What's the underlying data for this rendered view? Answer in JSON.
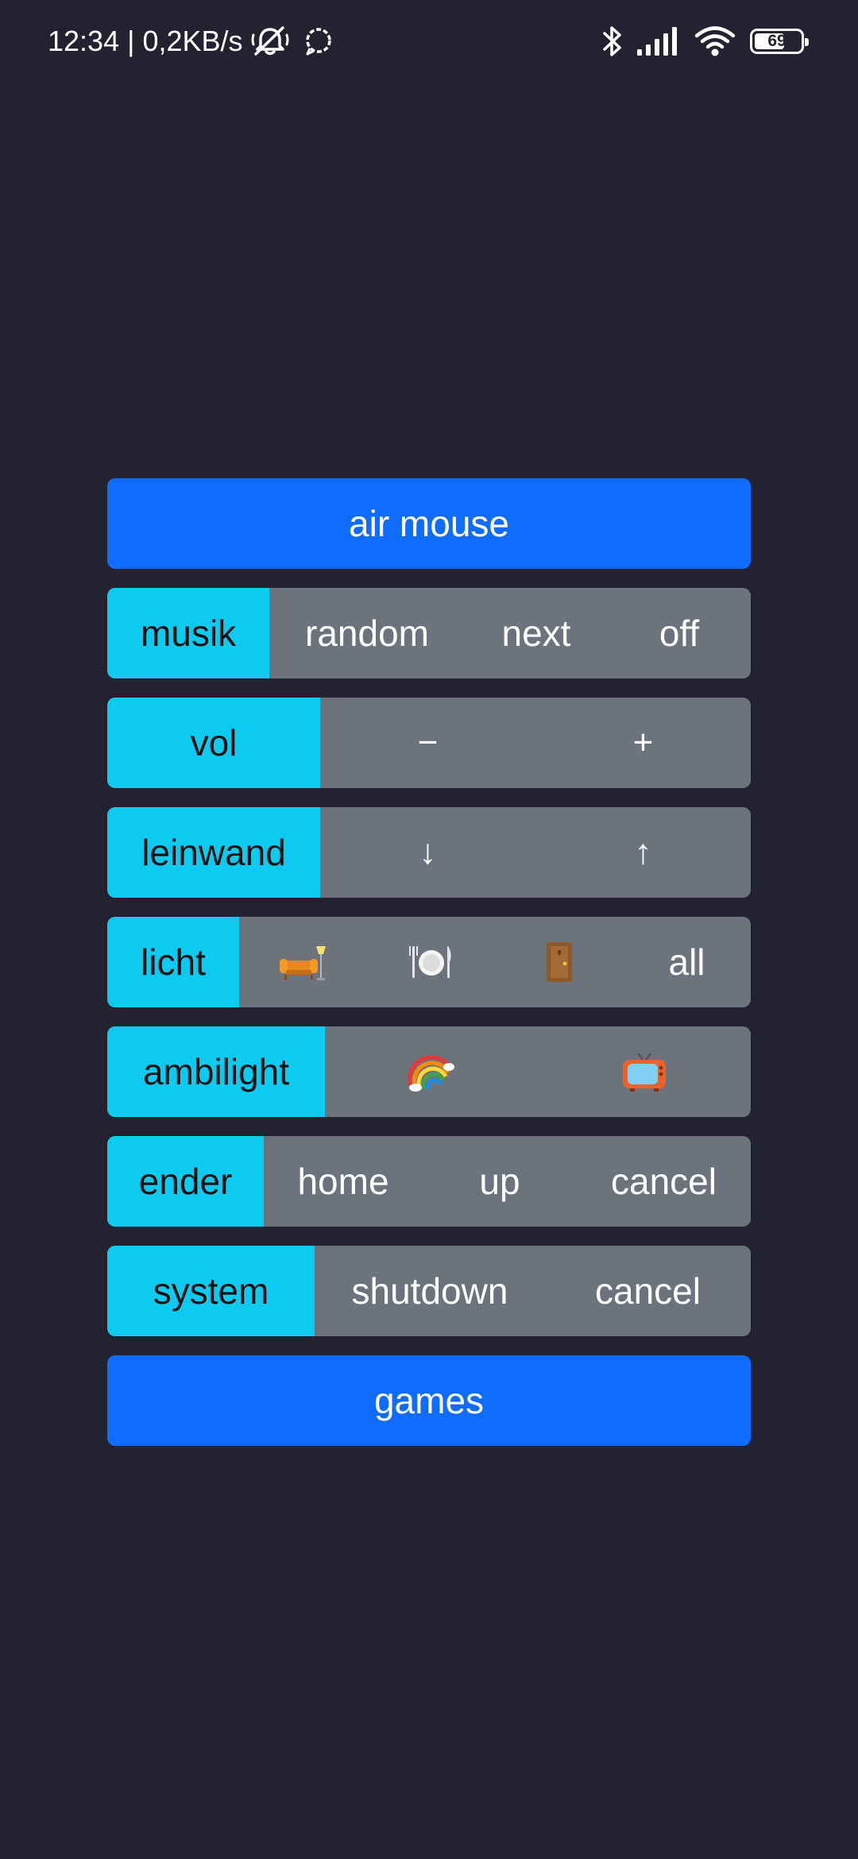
{
  "status_bar": {
    "time_speed": "12:34 | 0,2KB/s",
    "battery_level": "69",
    "battery_fraction": 0.69
  },
  "icons": {
    "status_left": [
      "notifications-off-icon",
      "chat-bubble-icon"
    ],
    "status_right": [
      "bluetooth-icon",
      "signal-icon",
      "wifi-icon",
      "battery-icon"
    ],
    "licht": [
      "sofa-lamp-icon",
      "plate-cutlery-icon",
      "door-icon"
    ],
    "ambilight": [
      "rainbow-icon",
      "tv-icon"
    ]
  },
  "colors": {
    "background": "#222231",
    "primary": "#0f6cfd",
    "label_cyan": "#0dcaf0",
    "button_gray": "#6c737d"
  },
  "panel": {
    "air_mouse": "air mouse",
    "musik": {
      "label": "musik",
      "random": "random",
      "next": "next",
      "off": "off"
    },
    "vol": {
      "label": "vol",
      "minus": "−",
      "plus": "+"
    },
    "leinwand": {
      "label": "leinwand",
      "down": "↓",
      "up": "↑"
    },
    "licht": {
      "label": "licht",
      "all": "all"
    },
    "ambilight": {
      "label": "ambilight"
    },
    "ender": {
      "label": "ender",
      "home": "home",
      "up": "up",
      "cancel": "cancel"
    },
    "system": {
      "label": "system",
      "shutdown": "shutdown",
      "cancel": "cancel"
    },
    "games": "games"
  }
}
